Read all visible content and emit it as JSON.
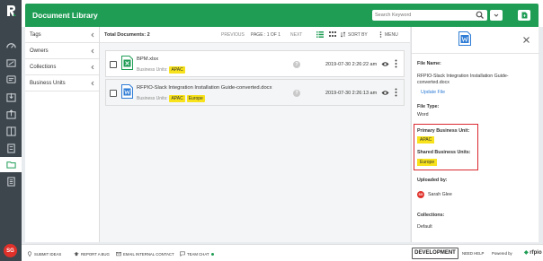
{
  "app": {
    "title": "Document Library",
    "search_placeholder": "Search Keyword"
  },
  "filters": [
    {
      "label": "Tags"
    },
    {
      "label": "Owners"
    },
    {
      "label": "Collections"
    },
    {
      "label": "Business Units"
    }
  ],
  "toolbar": {
    "total_documents": "Total Documents: 2",
    "previous": "PREVIOUS",
    "page_info": "PAGE : 1 OF 1",
    "next": "NEXT",
    "sort_by": "SORT BY",
    "menu": "MENU"
  },
  "documents": [
    {
      "name": "BPM.xlsx",
      "business_units_label": "Business Units:",
      "tags": [
        "APAC"
      ],
      "date": "2019-07-30 2:26:22 am",
      "file_type": "excel"
    },
    {
      "name": "RFPIO-Slack Integration Installation Guide-converted.docx",
      "business_units_label": "Business Units:",
      "tags": [
        "APAC",
        "Europe"
      ],
      "date": "2019-07-30 2:26:13 am",
      "file_type": "word"
    }
  ],
  "details": {
    "file_name_label": "File Name:",
    "file_name": "RFPIO-Slack Integration Installation Guide-converted.docx",
    "file_name_line1": "RFPIO-Slack Integration Installation Guide-",
    "file_name_line2": "converted.docx",
    "update_file": "Update File",
    "file_type_label": "File Type:",
    "file_type": "Word",
    "primary_bu_label": "Primary Business Unit:",
    "primary_bu": "APAC",
    "shared_bu_label": "Shared Business Units:",
    "shared_bu": "Europe",
    "uploaded_by_label": "Uploaded by:",
    "uploader_initials": "SG",
    "uploader_name": "Sarah Glee",
    "collections_label": "Collections:",
    "collections": "Default"
  },
  "footer": {
    "submit_ideas": "SUBMIT IDEAS",
    "report_bug": "REPORT A BUG",
    "email_contact": "EMAIL INTERNAL CONTACT",
    "team_chat": "TEAM CHAT",
    "development": "DEVELOPMENT",
    "need_help": "NEED HELP",
    "powered_by": "Powered by",
    "brand": "rfpio"
  },
  "user": {
    "initials": "SG"
  },
  "colors": {
    "accent": "#1f9d55",
    "tag": "#f7e21b",
    "highlight": "#d9282f",
    "rail": "#3d464d"
  },
  "rail_icons": [
    "dashboard-icon",
    "projects-icon",
    "answers-icon",
    "import-icon",
    "export-icon",
    "library-icon",
    "content-icon",
    "insights-icon",
    "document-library-icon",
    "reports-icon"
  ]
}
